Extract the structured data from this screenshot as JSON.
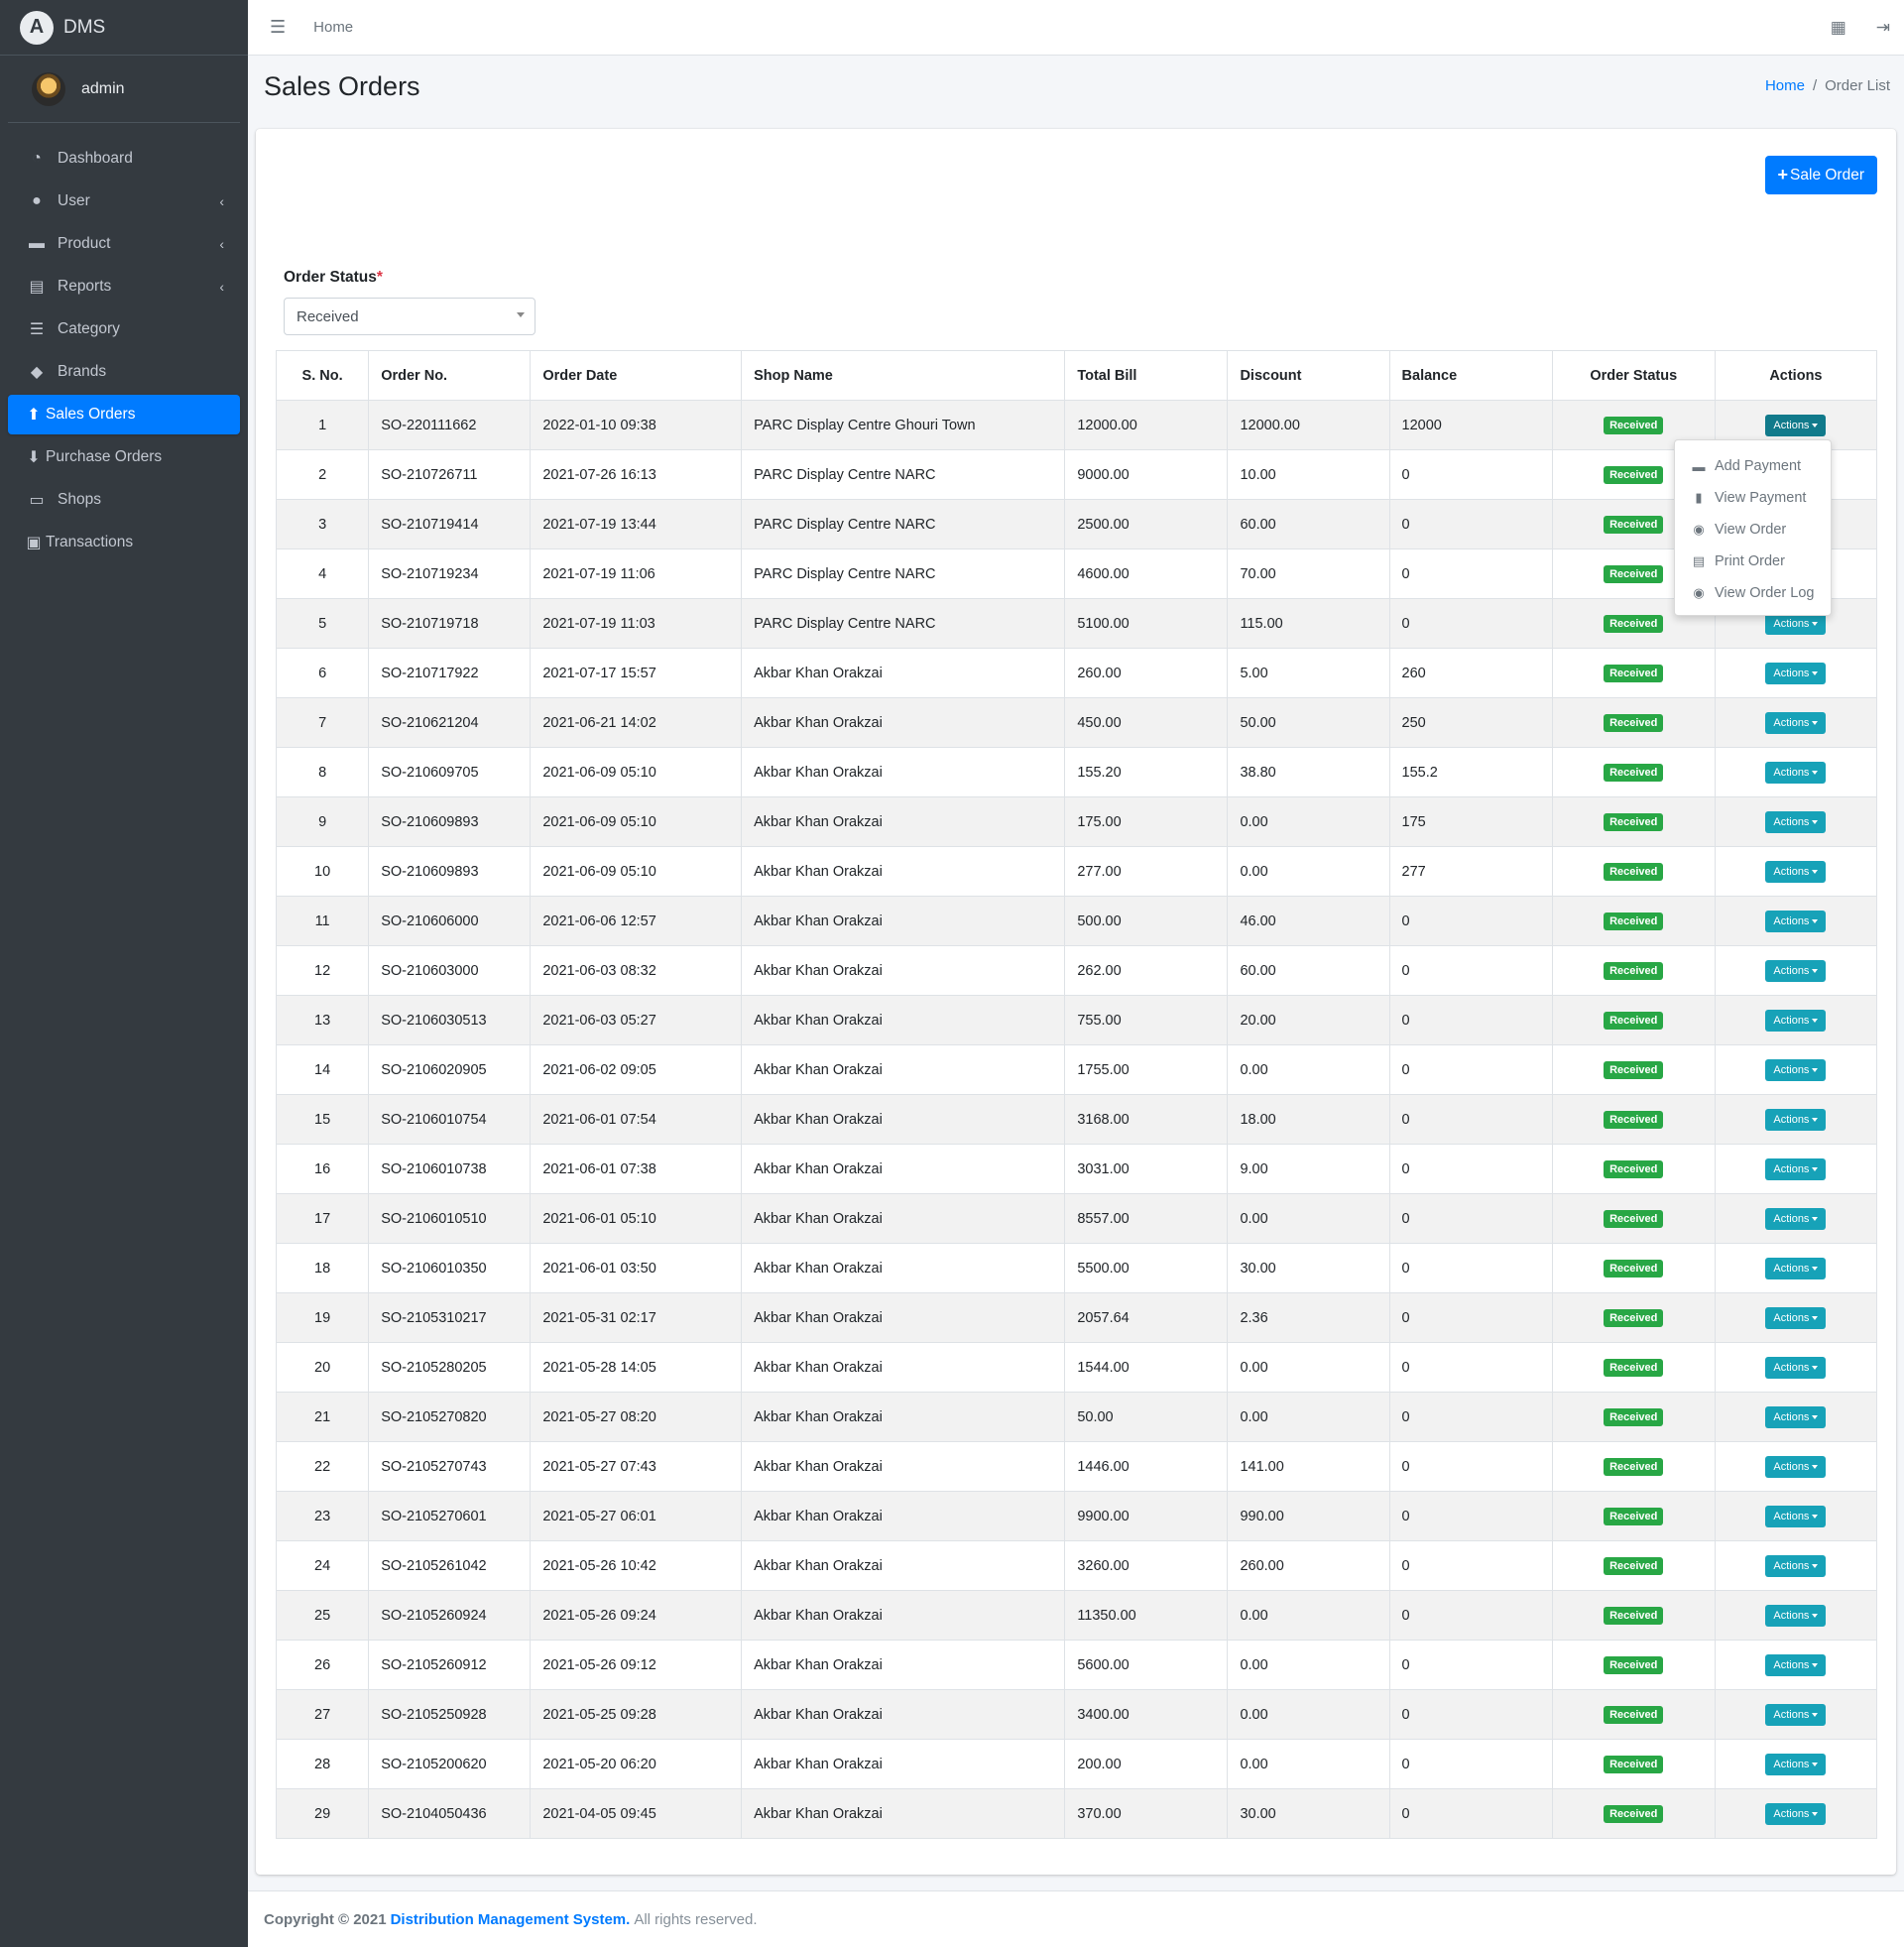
{
  "brand": {
    "name": "DMS",
    "logo_letter": "A"
  },
  "user": {
    "name": "admin"
  },
  "sidebar": {
    "items": [
      {
        "label": "Dashboard",
        "icon": "tachometer-icon",
        "glyph": "◔"
      },
      {
        "label": "User",
        "icon": "user-icon",
        "glyph": "●"
      },
      {
        "label": "Product",
        "icon": "box-icon",
        "glyph": "▬"
      },
      {
        "label": "Reports",
        "icon": "clipboard-icon",
        "glyph": "▤"
      },
      {
        "label": "Category",
        "icon": "list-icon",
        "glyph": "☰"
      },
      {
        "label": "Brands",
        "icon": "tag-icon",
        "glyph": "◆"
      },
      {
        "label": "Sales Orders",
        "icon": "arrow-circle-up-icon",
        "glyph": "⬆"
      },
      {
        "label": "Purchase Orders",
        "icon": "arrow-circle-down-icon",
        "glyph": "⬇"
      },
      {
        "label": "Shops",
        "icon": "store-icon",
        "glyph": "▭"
      },
      {
        "label": "Transactions",
        "icon": "money-bill-icon",
        "glyph": "▣"
      }
    ]
  },
  "topbar": {
    "home_label": "Home"
  },
  "header": {
    "title": "Sales Orders",
    "breadcrumb_home": "Home",
    "breadcrumb_sep": "/",
    "breadcrumb_current": "Order List"
  },
  "toolbar": {
    "sale_order_label": "Sale Order"
  },
  "filter": {
    "label": "Order Status",
    "required_mark": "*",
    "selected": "Received"
  },
  "table": {
    "columns": [
      "S. No.",
      "Order No.",
      "Order Date",
      "Shop Name",
      "Total Bill",
      "Discount",
      "Balance",
      "Order Status",
      "Actions"
    ],
    "status_label": "Received",
    "action_label": "Actions",
    "rows": [
      [
        "1",
        "SO-220111662",
        "2022-01-10 09:38",
        "PARC Display Centre Ghouri Town",
        "12000.00",
        "12000.00",
        "12000"
      ],
      [
        "2",
        "SO-210726711",
        "2021-07-26 16:13",
        "PARC Display Centre NARC",
        "9000.00",
        "10.00",
        "0"
      ],
      [
        "3",
        "SO-210719414",
        "2021-07-19 13:44",
        "PARC Display Centre NARC",
        "2500.00",
        "60.00",
        "0"
      ],
      [
        "4",
        "SO-210719234",
        "2021-07-19 11:06",
        "PARC Display Centre NARC",
        "4600.00",
        "70.00",
        "0"
      ],
      [
        "5",
        "SO-210719718",
        "2021-07-19 11:03",
        "PARC Display Centre NARC",
        "5100.00",
        "115.00",
        "0"
      ],
      [
        "6",
        "SO-210717922",
        "2021-07-17 15:57",
        "Akbar Khan Orakzai",
        "260.00",
        "5.00",
        "260"
      ],
      [
        "7",
        "SO-210621204",
        "2021-06-21 14:02",
        "Akbar Khan Orakzai",
        "450.00",
        "50.00",
        "250"
      ],
      [
        "8",
        "SO-210609705",
        "2021-06-09 05:10",
        "Akbar Khan Orakzai",
        "155.20",
        "38.80",
        "155.2"
      ],
      [
        "9",
        "SO-210609893",
        "2021-06-09 05:10",
        "Akbar Khan Orakzai",
        "175.00",
        "0.00",
        "175"
      ],
      [
        "10",
        "SO-210609893",
        "2021-06-09 05:10",
        "Akbar Khan Orakzai",
        "277.00",
        "0.00",
        "277"
      ],
      [
        "11",
        "SO-210606000",
        "2021-06-06 12:57",
        "Akbar Khan Orakzai",
        "500.00",
        "46.00",
        "0"
      ],
      [
        "12",
        "SO-210603000",
        "2021-06-03 08:32",
        "Akbar Khan Orakzai",
        "262.00",
        "60.00",
        "0"
      ],
      [
        "13",
        "SO-2106030513",
        "2021-06-03 05:27",
        "Akbar Khan Orakzai",
        "755.00",
        "20.00",
        "0"
      ],
      [
        "14",
        "SO-2106020905",
        "2021-06-02 09:05",
        "Akbar Khan Orakzai",
        "1755.00",
        "0.00",
        "0"
      ],
      [
        "15",
        "SO-2106010754",
        "2021-06-01 07:54",
        "Akbar Khan Orakzai",
        "3168.00",
        "18.00",
        "0"
      ],
      [
        "16",
        "SO-2106010738",
        "2021-06-01 07:38",
        "Akbar Khan Orakzai",
        "3031.00",
        "9.00",
        "0"
      ],
      [
        "17",
        "SO-2106010510",
        "2021-06-01 05:10",
        "Akbar Khan Orakzai",
        "8557.00",
        "0.00",
        "0"
      ],
      [
        "18",
        "SO-2106010350",
        "2021-06-01 03:50",
        "Akbar Khan Orakzai",
        "5500.00",
        "30.00",
        "0"
      ],
      [
        "19",
        "SO-2105310217",
        "2021-05-31 02:17",
        "Akbar Khan Orakzai",
        "2057.64",
        "2.36",
        "0"
      ],
      [
        "20",
        "SO-2105280205",
        "2021-05-28 14:05",
        "Akbar Khan Orakzai",
        "1544.00",
        "0.00",
        "0"
      ],
      [
        "21",
        "SO-2105270820",
        "2021-05-27 08:20",
        "Akbar Khan Orakzai",
        "50.00",
        "0.00",
        "0"
      ],
      [
        "22",
        "SO-2105270743",
        "2021-05-27 07:43",
        "Akbar Khan Orakzai",
        "1446.00",
        "141.00",
        "0"
      ],
      [
        "23",
        "SO-2105270601",
        "2021-05-27 06:01",
        "Akbar Khan Orakzai",
        "9900.00",
        "990.00",
        "0"
      ],
      [
        "24",
        "SO-2105261042",
        "2021-05-26 10:42",
        "Akbar Khan Orakzai",
        "3260.00",
        "260.00",
        "0"
      ],
      [
        "25",
        "SO-2105260924",
        "2021-05-26 09:24",
        "Akbar Khan Orakzai",
        "11350.00",
        "0.00",
        "0"
      ],
      [
        "26",
        "SO-2105260912",
        "2021-05-26 09:12",
        "Akbar Khan Orakzai",
        "5600.00",
        "0.00",
        "0"
      ],
      [
        "27",
        "SO-2105250928",
        "2021-05-25 09:28",
        "Akbar Khan Orakzai",
        "3400.00",
        "0.00",
        "0"
      ],
      [
        "28",
        "SO-2105200620",
        "2021-05-20 06:20",
        "Akbar Khan Orakzai",
        "200.00",
        "0.00",
        "0"
      ],
      [
        "29",
        "SO-2104050436",
        "2021-04-05 09:45",
        "Akbar Khan Orakzai",
        "370.00",
        "30.00",
        "0"
      ]
    ]
  },
  "dropdown": {
    "items": [
      {
        "label": "Add Payment",
        "icon": "money-bill-icon",
        "glyph": "▬"
      },
      {
        "label": "View Payment",
        "icon": "file-invoice-icon",
        "glyph": "▮"
      },
      {
        "label": "View Order",
        "icon": "eye-icon",
        "glyph": "◉"
      },
      {
        "label": "Print Order",
        "icon": "print-icon",
        "glyph": "▤"
      },
      {
        "label": "View Order Log",
        "icon": "eye-icon",
        "glyph": "◉"
      }
    ]
  },
  "footer": {
    "prefix": "Copyright © 2021",
    "link": "Distribution Management System.",
    "suffix": "All rights reserved."
  },
  "colors": {
    "sidebar_bg": "#343a40",
    "primary": "#007bff",
    "success": "#28a745",
    "info": "#17a2b8"
  }
}
